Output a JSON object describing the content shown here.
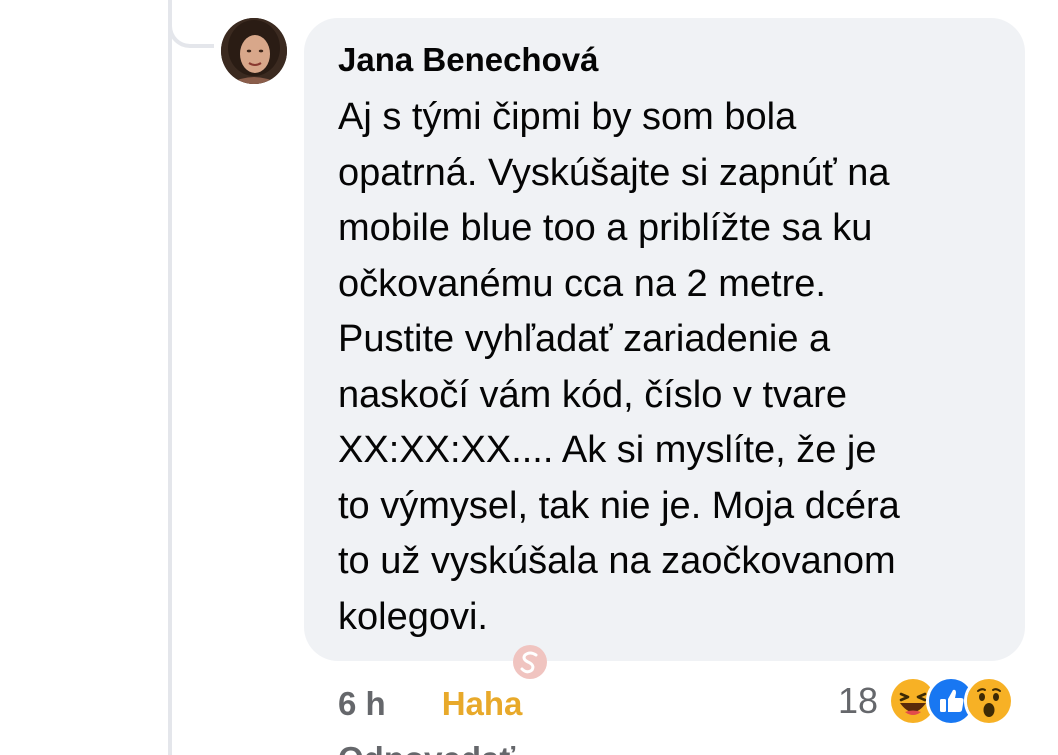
{
  "comment": {
    "author": "Jana Benechová",
    "text": " Aj s tými čipmi by som bola\nopatrná. Vyskúšajte si zapnúť na\nmobile blue too a priblížte sa ku\nočkovanému cca na 2 metre.\nPustite vyhľadať zariadenie a\nnaskočí vám kód, číslo v tvare\nXX:XX:XX.... Ak si myslíte, že je\nto výmysel, tak nie je. Moja dcéra\nto už vyskúšala na zaočkovanom\nkolegovi.",
    "time": "6 h",
    "user_reaction": "Haha",
    "reply_label": "Odpovedať",
    "reaction_count": "18",
    "reaction_icons": [
      "haha-icon",
      "like-icon",
      "wow-icon"
    ]
  },
  "colors": {
    "bubble_bg": "#f0f2f5",
    "haha_label": "#e8a92a",
    "meta_text": "#65676b",
    "like_blue": "#1877f2",
    "emoji_yellow": "#f7b125"
  }
}
